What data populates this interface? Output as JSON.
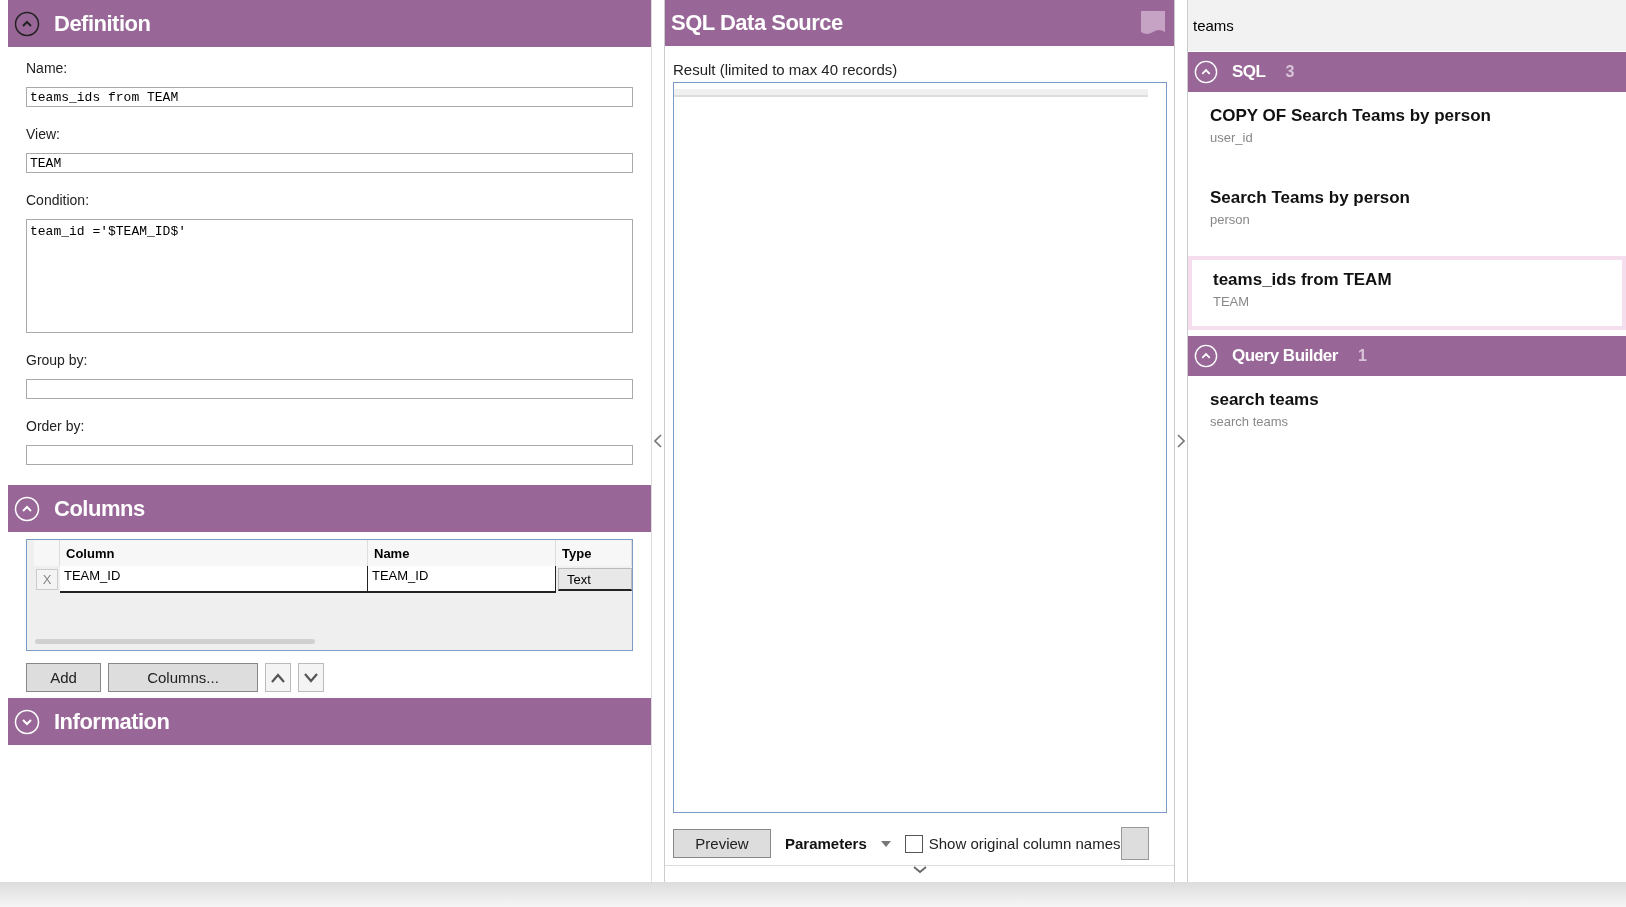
{
  "definition": {
    "title": "Definition",
    "expanded": true,
    "fields": [
      {
        "label": "Name:",
        "value": "teams_ids from TEAM",
        "kind": "line"
      },
      {
        "label": "View:",
        "value": "TEAM",
        "kind": "line"
      },
      {
        "label": "Condition:",
        "value": "team_id ='$TEAM_ID$'",
        "kind": "area"
      },
      {
        "label": "Group by:",
        "kind": "line"
      },
      {
        "label": "Order by:",
        "kind": "line"
      }
    ]
  },
  "columns": {
    "title": "Columns",
    "expanded": true,
    "table": {
      "headers": [
        "Column",
        "Name",
        "Type"
      ],
      "rows": [
        {
          "remove": "X",
          "cells": [
            "TEAM_ID",
            "TEAM_ID"
          ],
          "type": "Text"
        }
      ]
    },
    "buttons": [
      {
        "kind": "text",
        "label": "Add"
      },
      {
        "kind": "text",
        "label": "Columns..."
      },
      {
        "kind": "up"
      },
      {
        "kind": "down"
      }
    ]
  },
  "information": {
    "title": "Information",
    "expanded": false
  },
  "data_source": {
    "title": "SQL Data Source",
    "result_label": "Result (limited to max 40 records)",
    "preview_button": "Preview",
    "parameters_label": "Parameters",
    "show_original": {
      "label": "Show original column names",
      "checked": false
    }
  },
  "search": {
    "value": "teams"
  },
  "groups": [
    {
      "title": "SQL",
      "count": "3",
      "expanded": true,
      "items": [
        {
          "title": "COPY OF Search Teams by person",
          "subtitle": "user_id",
          "selected": false
        },
        {
          "title": "Search Teams by person",
          "subtitle": "person",
          "selected": false
        },
        {
          "title": "teams_ids from TEAM",
          "subtitle": "TEAM",
          "selected": true
        }
      ]
    },
    {
      "title": "Query Builder",
      "count": "1",
      "expanded": true,
      "items": [
        {
          "title": "search teams",
          "subtitle": "search teams",
          "selected": false
        }
      ]
    }
  ]
}
